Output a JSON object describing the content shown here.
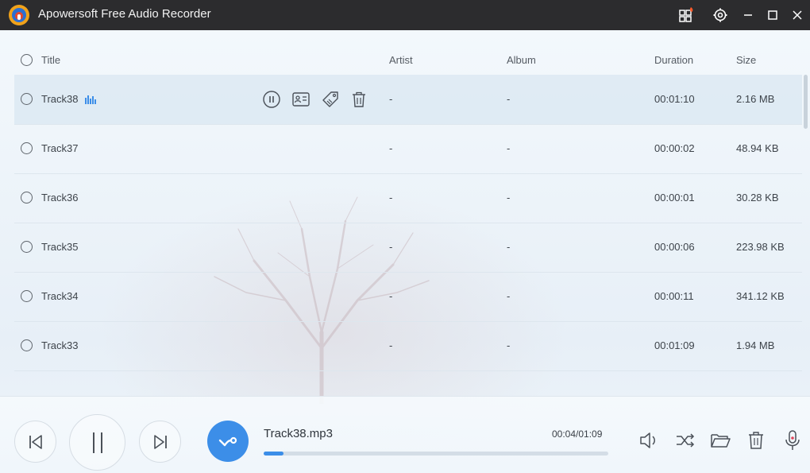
{
  "app": {
    "title": "Apowersoft Free Audio Recorder"
  },
  "colors": {
    "accent": "#3c8ee8",
    "titlebar": "#2c2c2e",
    "badge": "#ff5a2a"
  },
  "table": {
    "columns": {
      "title": "Title",
      "artist": "Artist",
      "album": "Album",
      "duration": "Duration",
      "size": "Size"
    },
    "rows": [
      {
        "title": "Track38",
        "artist": "-",
        "album": "-",
        "duration": "00:01:10",
        "size": "2.16 MB",
        "playing": true
      },
      {
        "title": "Track37",
        "artist": "-",
        "album": "-",
        "duration": "00:00:02",
        "size": "48.94 KB"
      },
      {
        "title": "Track36",
        "artist": "-",
        "album": "-",
        "duration": "00:00:01",
        "size": "30.28 KB"
      },
      {
        "title": "Track35",
        "artist": "-",
        "album": "-",
        "duration": "00:00:06",
        "size": "223.98 KB"
      },
      {
        "title": "Track34",
        "artist": "-",
        "album": "-",
        "duration": "00:00:11",
        "size": "341.12 KB"
      },
      {
        "title": "Track33",
        "artist": "-",
        "album": "-",
        "duration": "00:01:09",
        "size": "1.94 MB"
      }
    ],
    "row_action_icons": [
      "pause-icon",
      "id-card-icon",
      "tag-icon",
      "trash-icon"
    ]
  },
  "player": {
    "now_playing": "Track38.mp3",
    "time": "00:04/01:09",
    "progress": 0.058
  },
  "icons": {
    "titlebar": [
      "apps-grid-icon",
      "settings-gear-icon",
      "minimize-icon",
      "maximize-icon",
      "close-icon"
    ],
    "player": [
      "previous-track-icon",
      "pause-icon",
      "next-track-icon",
      "record-icon"
    ],
    "right_controls": [
      "volume-icon",
      "shuffle-icon",
      "folder-icon",
      "trash-icon",
      "microphone-icon"
    ]
  }
}
